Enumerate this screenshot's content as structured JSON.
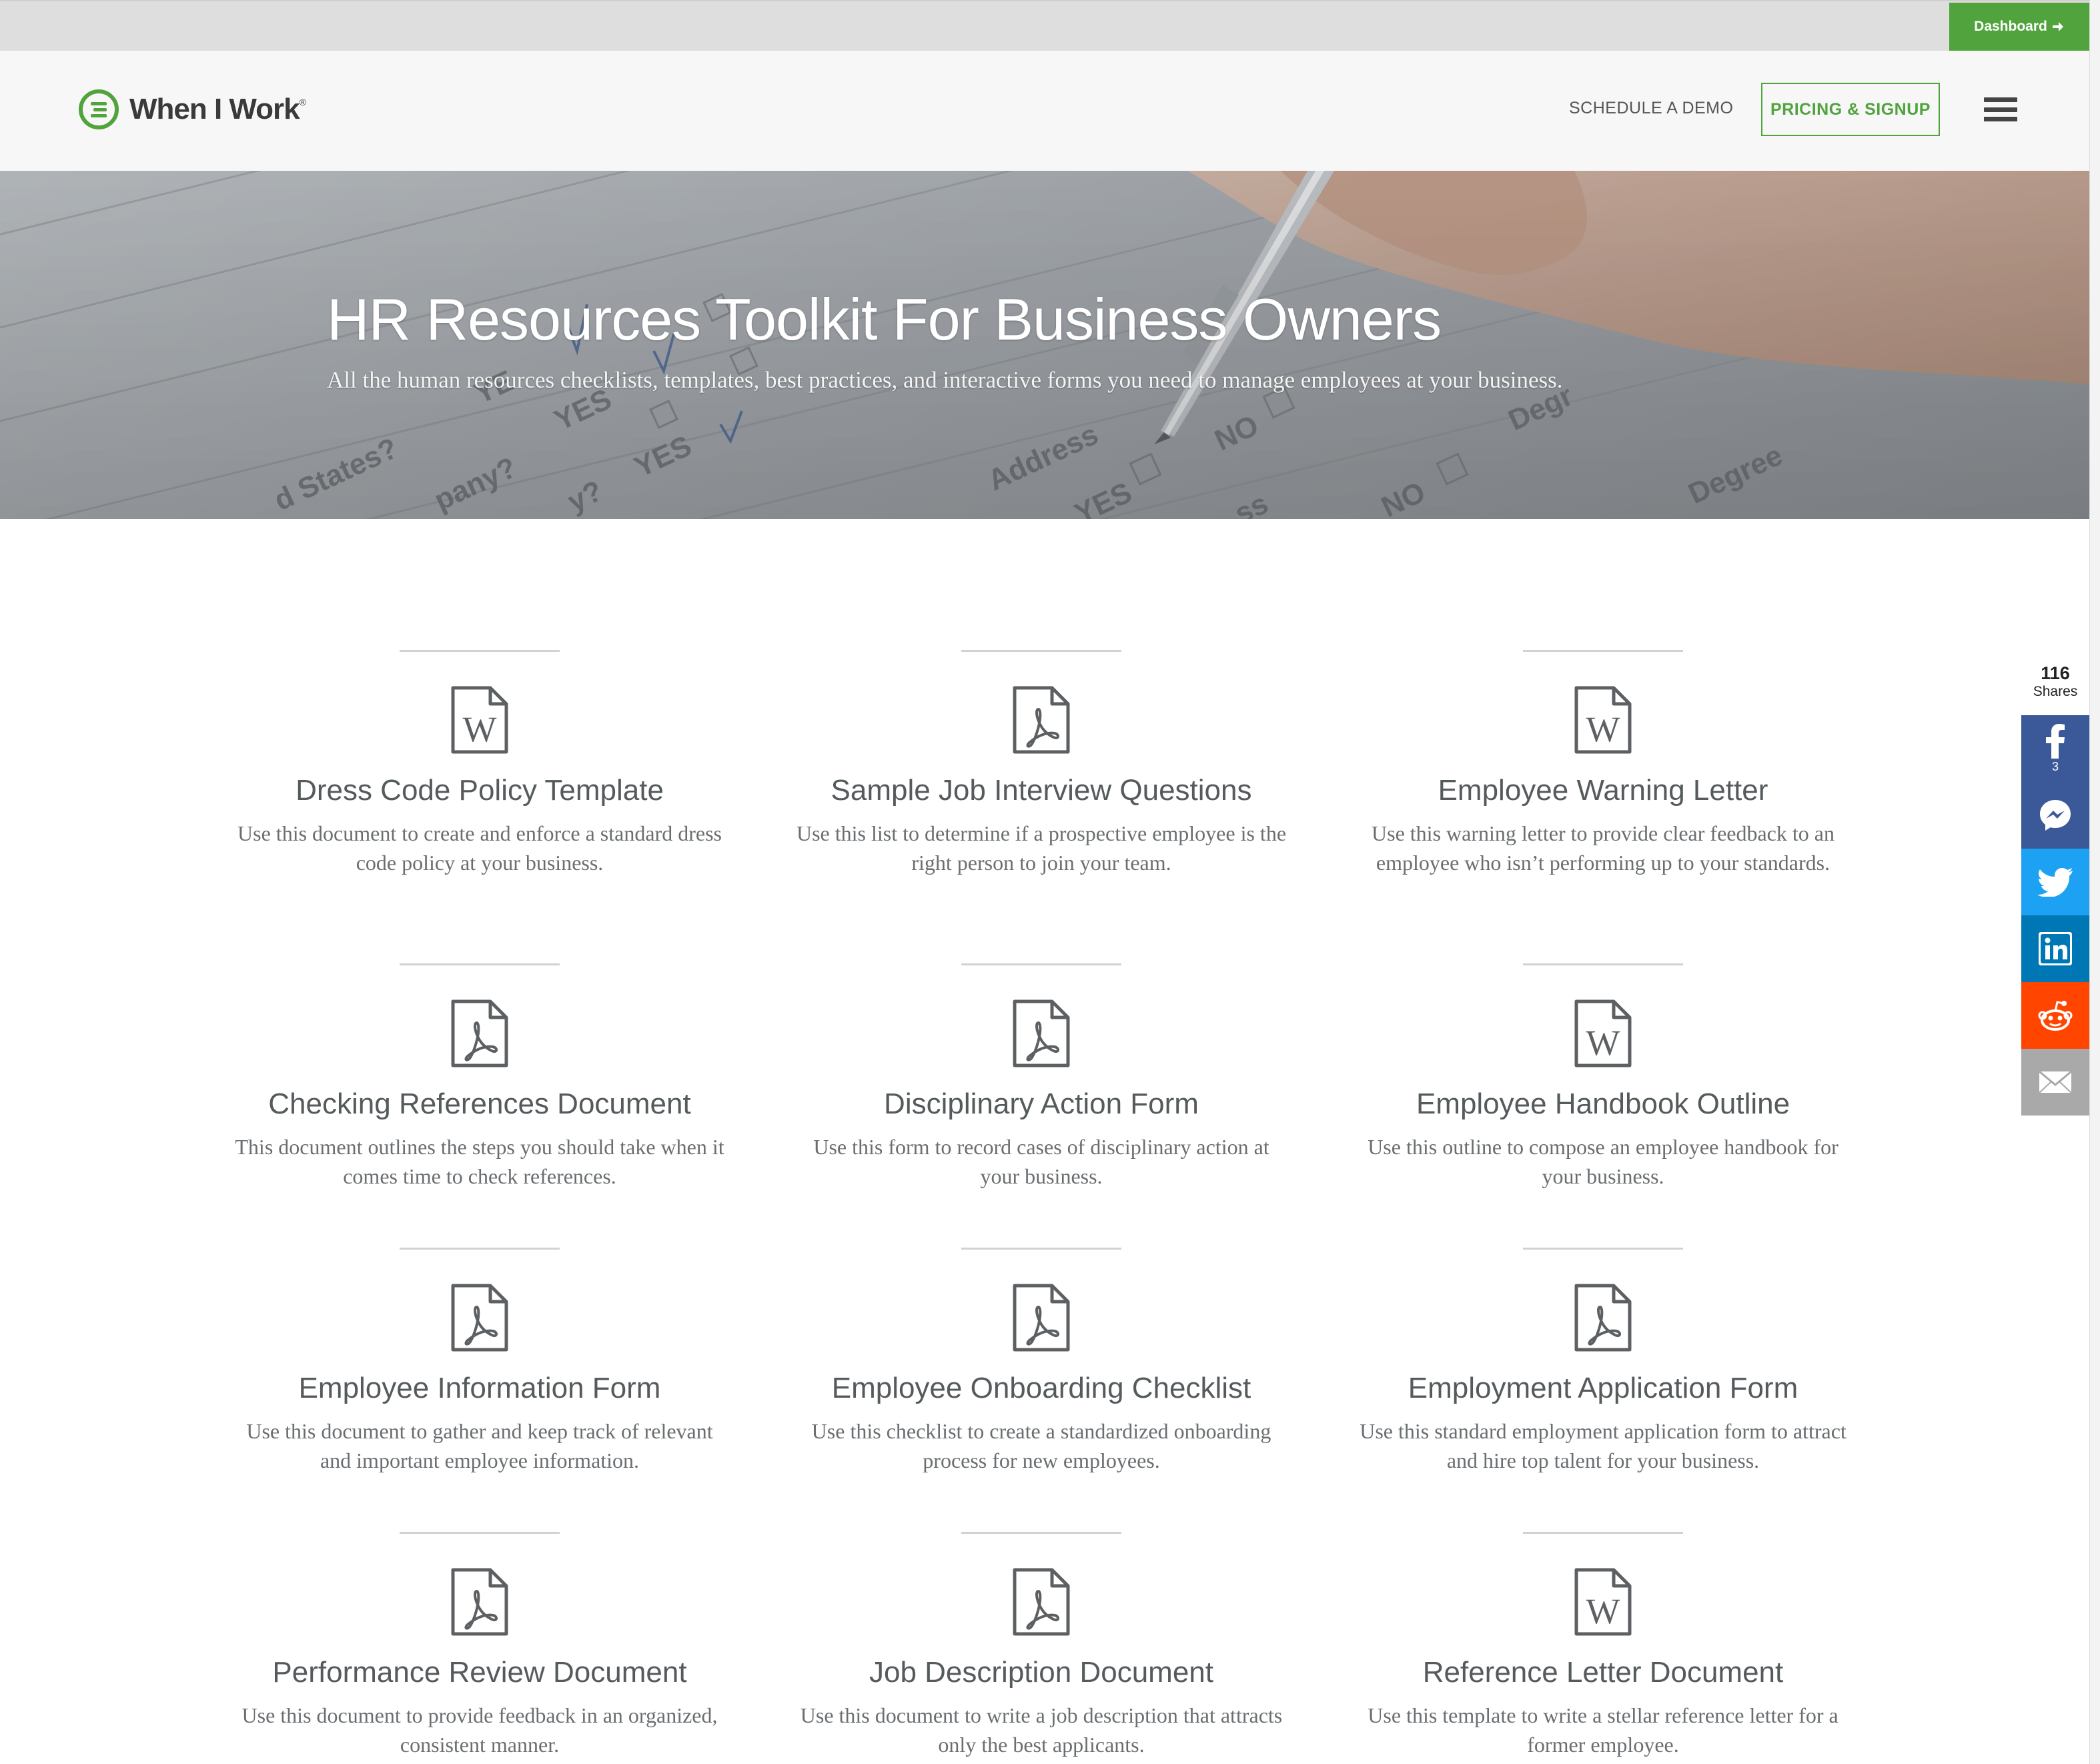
{
  "topbar": {
    "dashboard_label": "Dashboard",
    "dashboard_icon": "arrow-right-icon",
    "accent_color": "#51a33d"
  },
  "header": {
    "logo_text": "When I Work",
    "logo_mark": "®",
    "nav": {
      "demo_label": "SCHEDULE A DEMO",
      "pricing_label": "PRICING & SIGNUP",
      "menu_icon": "hamburger-menu-icon"
    }
  },
  "hero": {
    "title": "HR Resources Toolkit For Business Owners",
    "subtitle": "All the human resources checklists, templates, best practices, and interactive forms you need to manage employees at your business."
  },
  "resources": [
    {
      "icon": "word-doc-icon",
      "title": "Dress Code Policy Template",
      "description": "Use this document to create and enforce a standard dress code policy at your business."
    },
    {
      "icon": "pdf-doc-icon",
      "title": "Sample Job Interview Questions",
      "description": "Use this list to determine if a prospective employee is the right person to join your team."
    },
    {
      "icon": "word-doc-icon",
      "title": "Employee Warning Letter",
      "description": "Use this warning letter to provide clear feedback to an employee who isn’t performing up to your standards."
    },
    {
      "icon": "pdf-doc-icon",
      "title": "Checking References Document",
      "description": "This document outlines the steps you should take when it comes time to check references."
    },
    {
      "icon": "pdf-doc-icon",
      "title": "Disciplinary Action Form",
      "description": "Use this form to record cases of disciplinary action at your business."
    },
    {
      "icon": "word-doc-icon",
      "title": "Employee Handbook Outline",
      "description": "Use this outline to compose an employee handbook for your business."
    },
    {
      "icon": "pdf-doc-icon",
      "title": "Employee Information Form",
      "description": "Use this document to gather and keep track of relevant and important employee information."
    },
    {
      "icon": "pdf-doc-icon",
      "title": "Employee Onboarding Checklist",
      "description": "Use this checklist to create a standardized onboarding process for new employees."
    },
    {
      "icon": "pdf-doc-icon",
      "title": "Employment Application Form",
      "description": "Use this standard employment application form to attract and hire top talent for your business."
    },
    {
      "icon": "pdf-doc-icon",
      "title": "Performance Review Document",
      "description": "Use this document to provide feedback in an organized, consistent manner."
    },
    {
      "icon": "pdf-doc-icon",
      "title": "Job Description Document",
      "description": "Use this document to write a job description that attracts only the best applicants."
    },
    {
      "icon": "word-doc-icon",
      "title": "Reference Letter Document",
      "description": "Use this template to write a stellar reference letter for a former employee."
    }
  ],
  "share": {
    "count": "116",
    "count_label": "Shares",
    "buttons": [
      {
        "icon": "facebook-icon",
        "count": "3",
        "color": "#3b5998"
      },
      {
        "icon": "messenger-icon",
        "count": "",
        "color": "#3b5998"
      },
      {
        "icon": "twitter-icon",
        "count": "",
        "color": "#1da1f2"
      },
      {
        "icon": "linkedin-icon",
        "count": "",
        "color": "#0077b5"
      },
      {
        "icon": "reddit-icon",
        "count": "",
        "color": "#ff4500"
      },
      {
        "icon": "email-icon",
        "count": "",
        "color": "#a9a9a9"
      }
    ]
  }
}
